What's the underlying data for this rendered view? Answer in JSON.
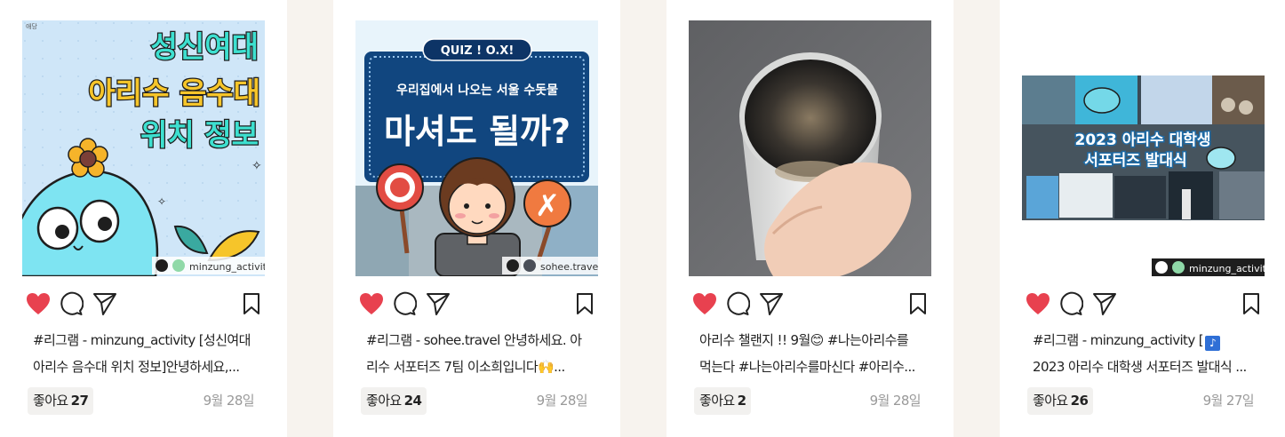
{
  "posts": [
    {
      "caption_line1": "#리그램 - minzung_activity [성신여대",
      "caption_line2": "아리수 음수대 위치 정보]안녕하세요,...",
      "likes_label": "좋아요",
      "likes_count": "27",
      "date": "9월 28일",
      "image": {
        "title_line1": "성신여대",
        "title_line2": "아리수 음수대",
        "title_line3": "위치 정보",
        "account_tag": "minzung_activit",
        "corner_mark": "애당"
      }
    },
    {
      "caption_line1": "#리그램 - sohee.travel 안녕하세요. 아",
      "caption_line2": "리수 서포터즈 7팀 이소희입니다🙌...",
      "likes_label": "좋아요",
      "likes_count": "24",
      "date": "9월 28일",
      "image": {
        "quiz_label": "QUIZ ! O.X!",
        "subtitle": "우리집에서 나오는 서울 수돗물",
        "title": "마셔도 될까?",
        "account_tag": "sohee.trave"
      }
    },
    {
      "caption_line1": "아리수 챌랜지 !! 9월😊 #나는아리수를",
      "caption_line2": "먹는다 #나는아리수를마신다 #아리수...",
      "likes_label": "좋아요",
      "likes_count": "2",
      "date": "9월 28일",
      "image": {}
    },
    {
      "caption_line1": "#리그램 - minzung_activity [",
      "caption_line2": "2023 아리수 대학생 서포터즈 발대식 ...",
      "likes_label": "좋아요",
      "likes_count": "26",
      "date": "9월 27일",
      "image": {
        "title_line1": "2023 아리수 대학생",
        "title_line2": "서포터즈 발대식",
        "account_tag": "minzung_activit"
      }
    }
  ],
  "icons": {
    "like": "heart-icon",
    "comment": "comment-icon",
    "share": "share-icon",
    "save": "bookmark-icon",
    "regram": "regram-icon"
  },
  "colors": {
    "heart": "#e8414f",
    "cyan_title": "#3de0d0",
    "navy": "#11467f"
  }
}
